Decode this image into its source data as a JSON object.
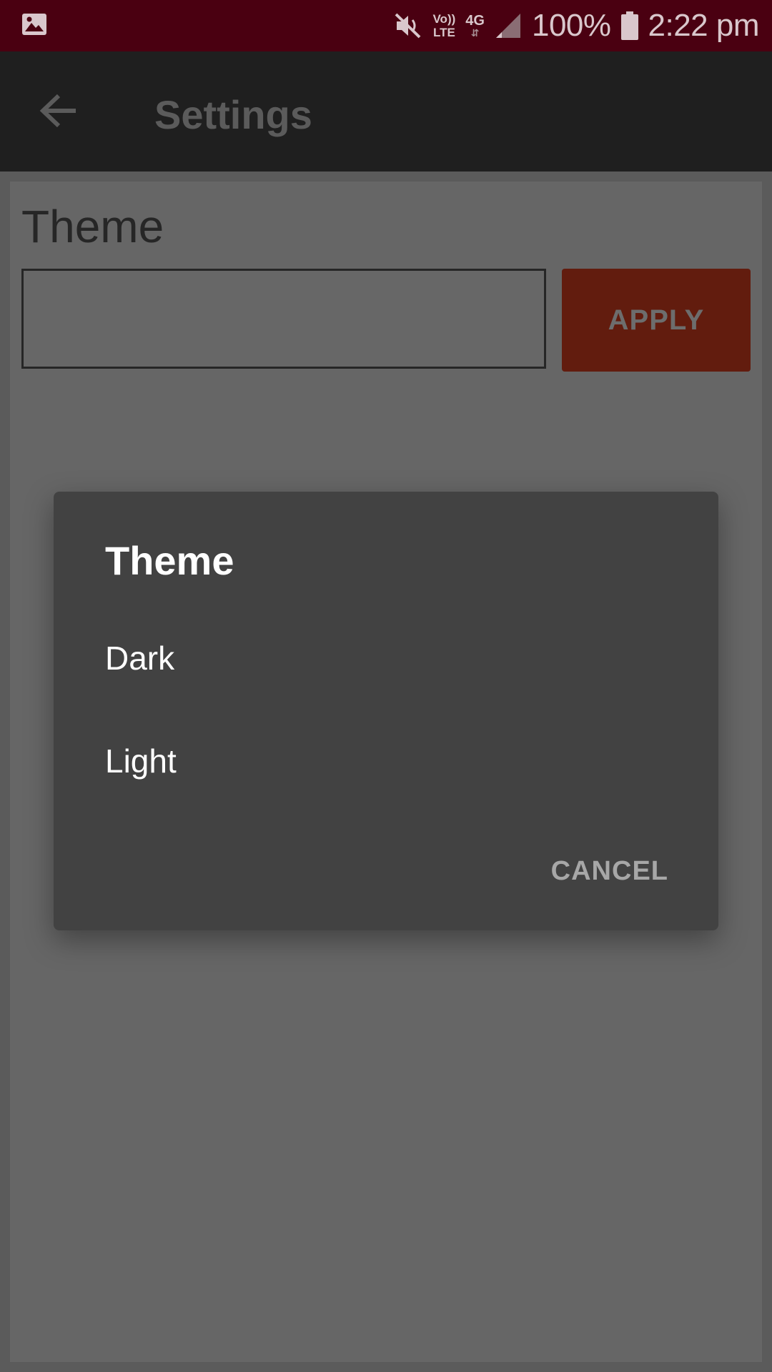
{
  "status_bar": {
    "left_icon": "image-icon",
    "icons": [
      "mute-icon",
      "volte-icon",
      "4g-icon",
      "signal-icon",
      "battery-icon"
    ],
    "volte_top": "Vo))",
    "volte_bottom": "LTE",
    "network": "4G",
    "battery": "100%",
    "time": "2:22 pm",
    "background": "#4a0011"
  },
  "app_bar": {
    "title": "Settings",
    "back_icon": "arrow-left-icon",
    "background": "#1f1f1f"
  },
  "settings": {
    "section_title": "Theme",
    "input_value": "",
    "apply_label": "APPLY",
    "apply_color": "#621c0e"
  },
  "dialog": {
    "title": "Theme",
    "options": [
      {
        "label": "Dark"
      },
      {
        "label": "Light"
      }
    ],
    "cancel_label": "CANCEL",
    "background": "#424242"
  }
}
